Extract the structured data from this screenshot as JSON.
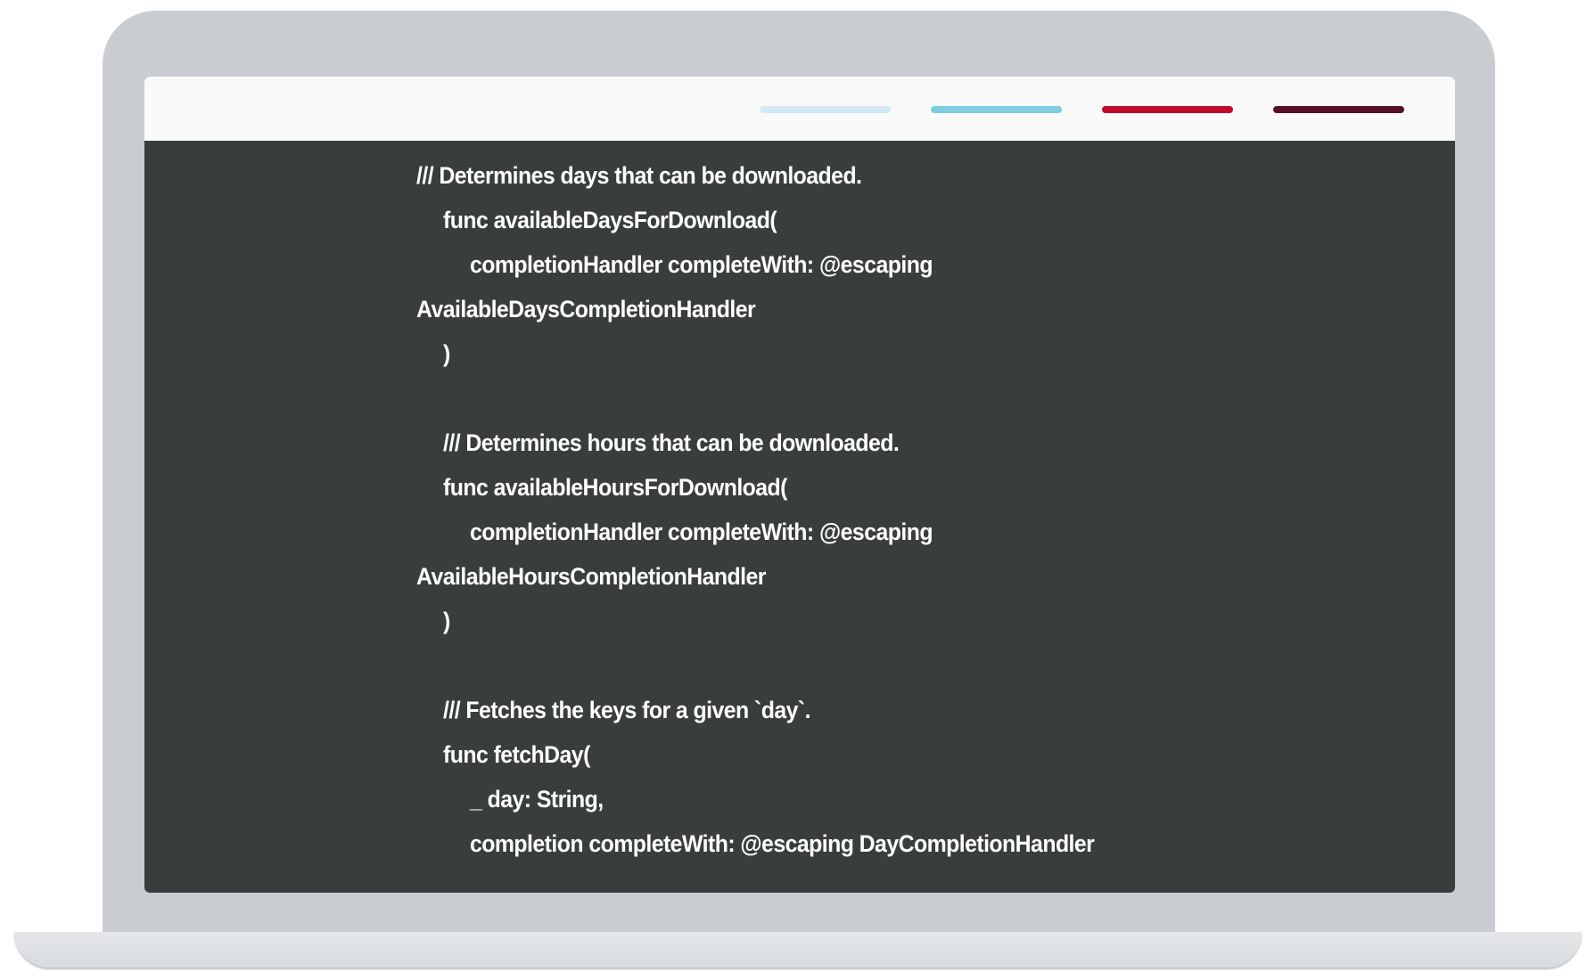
{
  "header": {
    "indicators": [
      {
        "name": "indicator-light-blue",
        "color": "#d3e8f5"
      },
      {
        "name": "indicator-blue",
        "color": "#7fcde2"
      },
      {
        "name": "indicator-red",
        "color": "#c00d2e"
      },
      {
        "name": "indicator-maroon",
        "color": "#56102a"
      }
    ]
  },
  "code": {
    "lines": [
      {
        "indent": 0,
        "text": "/// Determines days that can be downloaded."
      },
      {
        "indent": 1,
        "text": "func availableDaysForDownload("
      },
      {
        "indent": 2,
        "text": "completionHandler completeWith: @escaping"
      },
      {
        "indent": 0,
        "text": "AvailableDaysCompletionHandler"
      },
      {
        "indent": 1,
        "text": ")"
      },
      {
        "indent": 0,
        "text": ""
      },
      {
        "indent": 1,
        "text": "/// Determines hours that can be downloaded."
      },
      {
        "indent": 1,
        "text": "func availableHoursForDownload("
      },
      {
        "indent": 2,
        "text": "completionHandler completeWith: @escaping"
      },
      {
        "indent": 0,
        "text": "AvailableHoursCompletionHandler"
      },
      {
        "indent": 1,
        "text": ")"
      },
      {
        "indent": 0,
        "text": ""
      },
      {
        "indent": 1,
        "text": "/// Fetches the keys for a given `day`."
      },
      {
        "indent": 1,
        "text": "func fetchDay("
      },
      {
        "indent": 2,
        "text": "_ day: String,"
      },
      {
        "indent": 2,
        "text": "completion completeWith: @escaping DayCompletionHandler"
      }
    ]
  },
  "colors": {
    "code_background": "#3a3d3e",
    "code_text": "#ffffff",
    "device_frame": "#c9cdd1"
  }
}
